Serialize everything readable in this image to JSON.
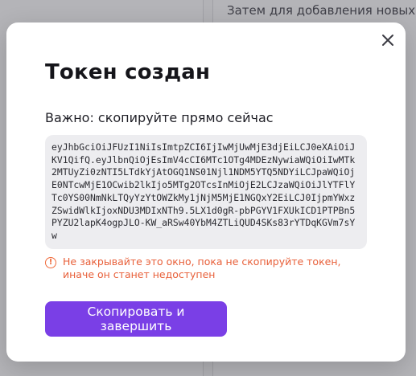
{
  "background": {
    "right_hint_text": "Затем для добавления новых"
  },
  "modal": {
    "title": "Токен создан",
    "subtitle": "Важно: скопируйте прямо сейчас",
    "token": "eyJhbGciOiJFUzI1NiIsImtpZCI6IjIwMjUwMjE3djEiLCJ0eXAiOiJKV1QifQ.eyJlbnQiOjEsImV4cCI6MTc1OTg4MDEzNywiaWQiOiIwMTk2MTUyZi0zNTI5LTdkYjAtOGQ1NS01Njl1NDM5YTQ5NDYiLCJpaWQiOjE0NTcwMjE1OCwib2lkIjo5MTg2OTcsInMiOjE2LCJzaWQiOiJlYTFlYTc0YS00NmNkLTQyYzYtOWZkMy1jNjM5MjE1NGQxY2EiLCJ0IjpmYWxzZSwidWlkIjoxNDU3MDIxNTh9.5LX1d0gR-pbPGYV1FXUkICD1PTPBn5PYZU2lapK4ogpJLO-KW_aRSw40YbM4ZTLiQUD4SKs83rYTDqKGVm7sYw",
    "warning": "Не закрывайте это окно, пока не скопируйте токен, иначе он станет недоступен",
    "primary_button_label": "Скопировать и завершить"
  },
  "colors": {
    "accent": "#7a3fe6",
    "warning": "#e8603a"
  },
  "icons": {
    "close": "close-icon",
    "warning": "warning-icon"
  }
}
